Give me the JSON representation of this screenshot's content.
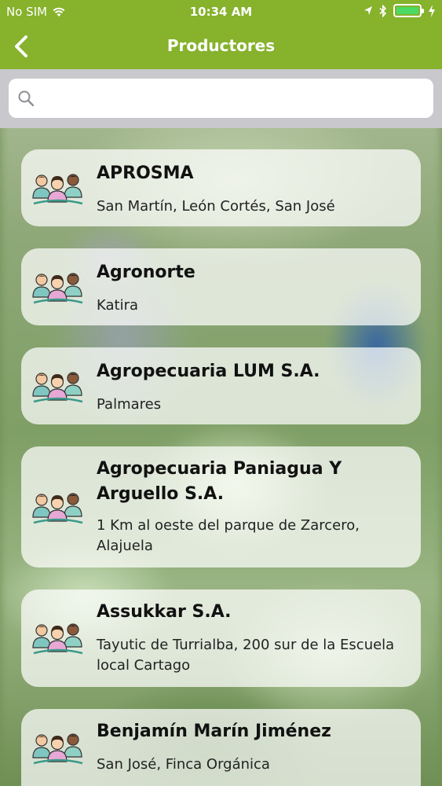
{
  "status_bar": {
    "carrier": "No SIM",
    "time": "10:34 AM",
    "battery_level": 1.0,
    "battery_color": "#4cd964",
    "icons": [
      "wifi-icon",
      "location-arrow-icon",
      "bluetooth-icon",
      "battery-icon"
    ]
  },
  "nav": {
    "title": "Productores",
    "back_icon": "chevron-left-icon",
    "bar_color": "#86b22c"
  },
  "search": {
    "placeholder": "",
    "value": "",
    "icon": "search-icon"
  },
  "producers": [
    {
      "name": "APROSMA",
      "address": "San Martín, León Cortés, San José",
      "icon": "group-people-icon"
    },
    {
      "name": "Agronorte",
      "address": "Katira",
      "icon": "group-people-icon"
    },
    {
      "name": "Agropecuaria LUM S.A.",
      "address": "Palmares",
      "icon": "group-people-icon"
    },
    {
      "name": "Agropecuaria Paniagua Y Arguello S.A.",
      "address": "1 Km al oeste del parque de Zarcero, Alajuela",
      "icon": "group-people-icon"
    },
    {
      "name": "Assukkar S.A.",
      "address": "Tayutic de Turrialba, 200 sur de la Escuela local Cartago",
      "icon": "group-people-icon"
    },
    {
      "name": "Benjamín Marín Jiménez",
      "address": "San José, Finca Orgánica",
      "icon": "group-people-icon"
    }
  ]
}
